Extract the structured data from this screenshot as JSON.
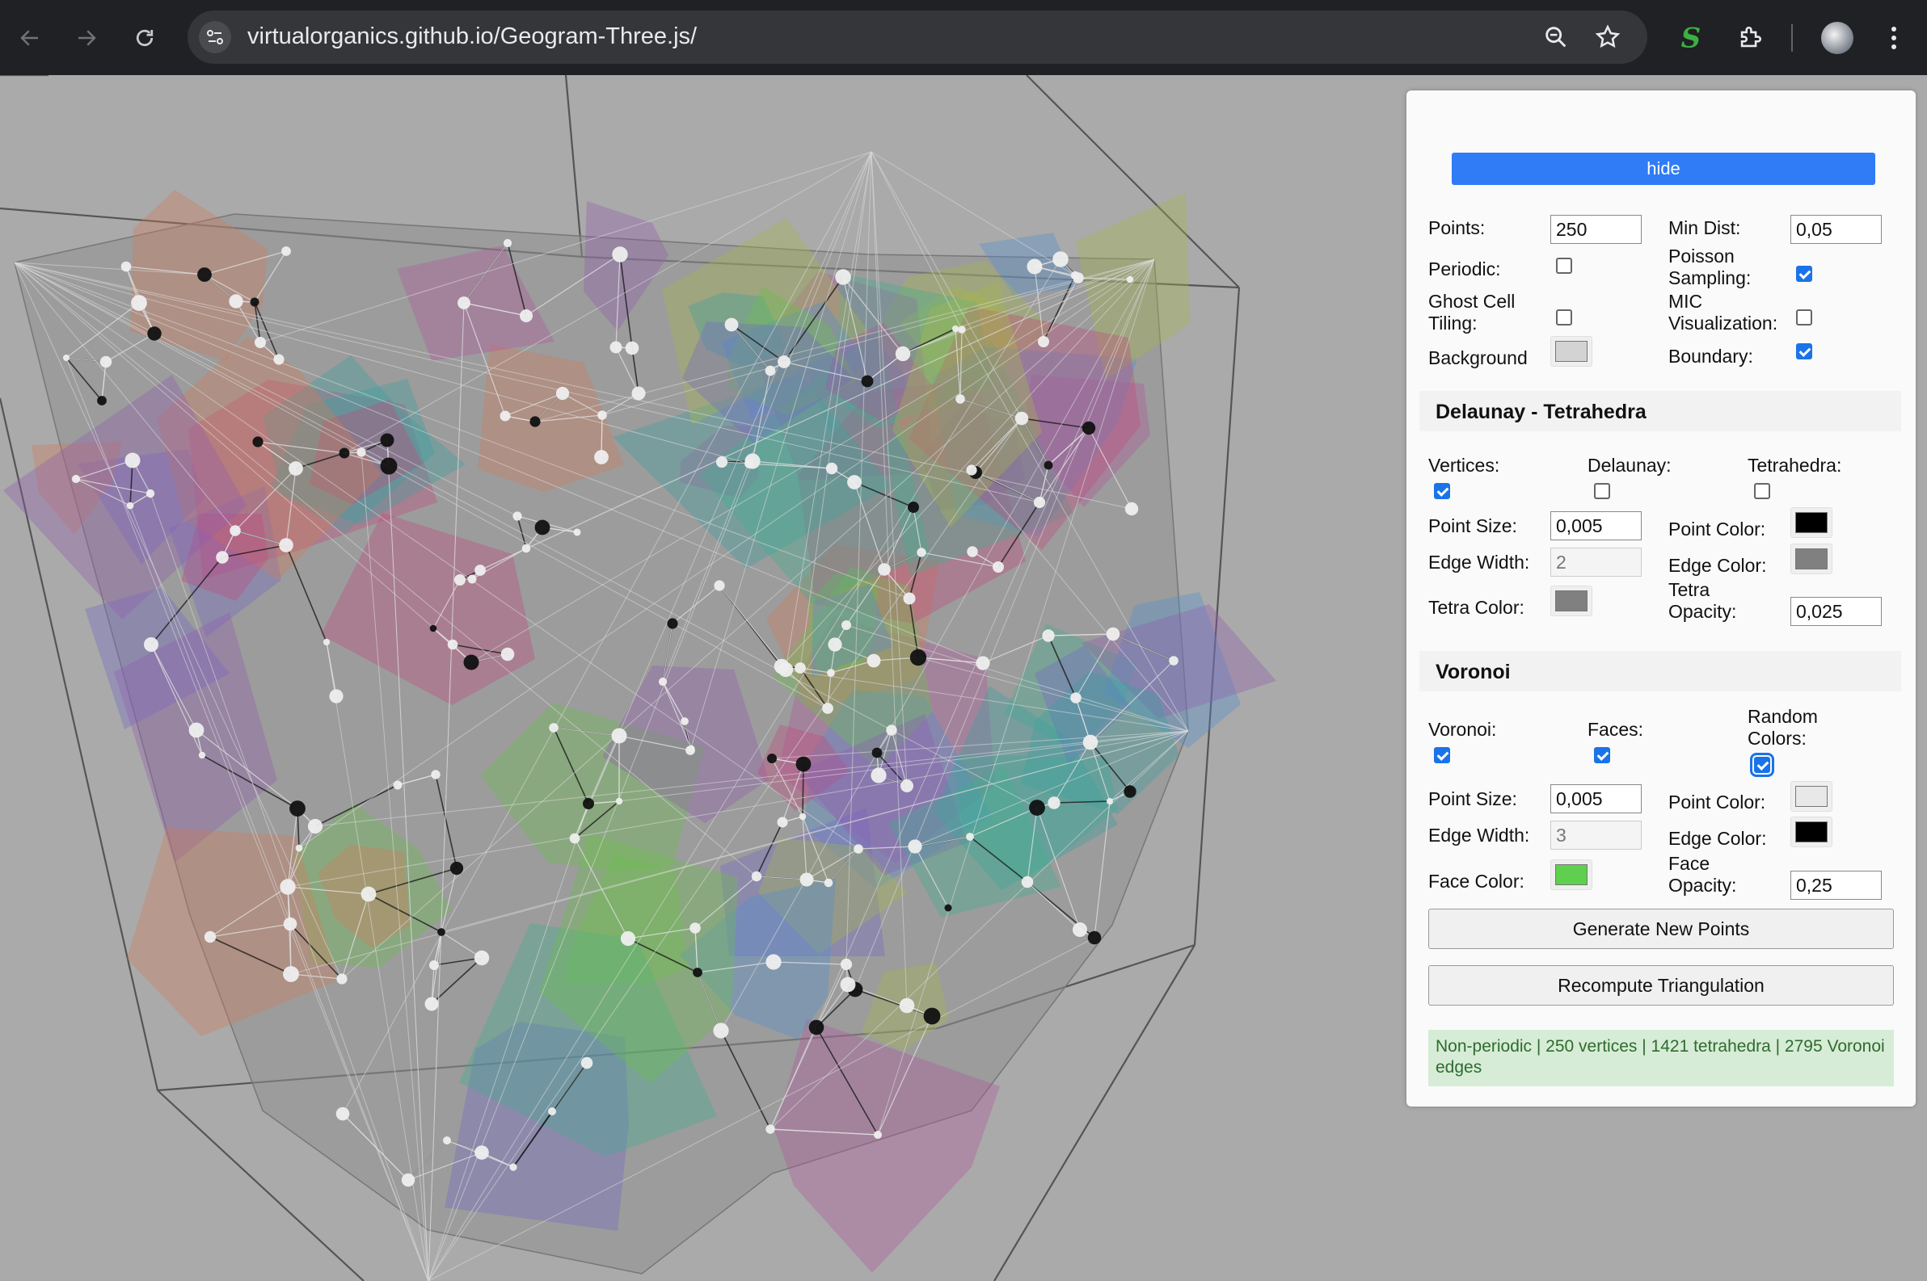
{
  "browser": {
    "url": "virtualorganics.github.io/Geogram-Three.js/",
    "icons": [
      "back-arrow-icon",
      "forward-arrow-icon",
      "reload-icon",
      "site-info-icon",
      "zoom-icon",
      "bookmark-star-icon",
      "extension-s-icon",
      "extensions-puzzle-icon",
      "profile-avatar",
      "more-menu-icon"
    ]
  },
  "panel": {
    "hide_label": "hide",
    "points_label": "Points:",
    "points_value": "250",
    "min_dist_label": "Min Dist:",
    "min_dist_value": "0,05",
    "periodic_label": "Periodic:",
    "periodic_checked": false,
    "poisson_label_1": "Poisson",
    "poisson_label_2": "Sampling:",
    "poisson_checked": true,
    "ghost_label_1": "Ghost Cell",
    "ghost_label_2": "Tiling:",
    "ghost_checked": false,
    "mic_label_1": "MIC",
    "mic_label_2": "Visualization:",
    "mic_checked": false,
    "background_label": "Background",
    "background_color": "#d3d3d3",
    "boundary_label": "Boundary:",
    "boundary_checked": true,
    "delaunay_section": {
      "title": "Delaunay - Tetrahedra",
      "vertices_label": "Vertices:",
      "vertices_checked": true,
      "delaunay_label": "Delaunay:",
      "delaunay_checked": false,
      "tetrahedra_label": "Tetrahedra:",
      "tetrahedra_checked": false,
      "point_size_label": "Point Size:",
      "point_size_value": "0,005",
      "point_color_label": "Point Color:",
      "point_color": "#000000",
      "edge_width_label": "Edge Width:",
      "edge_width_value": "2",
      "edge_color_label": "Edge Color:",
      "edge_color": "#808080",
      "tetra_color_label": "Tetra Color:",
      "tetra_color": "#808080",
      "tetra_opacity_label_1": "Tetra",
      "tetra_opacity_label_2": "Opacity:",
      "tetra_opacity_value": "0,025"
    },
    "voronoi_section": {
      "title": "Voronoi",
      "voronoi_label": "Voronoi:",
      "voronoi_checked": true,
      "faces_label": "Faces:",
      "faces_checked": true,
      "random_colors_label_1": "Random",
      "random_colors_label_2": "Colors:",
      "random_colors_checked": true,
      "point_size_label": "Point Size:",
      "point_size_value": "0,005",
      "point_color_label": "Point Color:",
      "point_color": "#e8e8e8",
      "edge_width_label": "Edge Width:",
      "edge_width_value": "3",
      "edge_color_label": "Edge Color:",
      "edge_color": "#000000",
      "face_color_label": "Face Color:",
      "face_color": "#5fcf4f",
      "face_opacity_label_1": "Face",
      "face_opacity_label_2": "Opacity:",
      "face_opacity_value": "0,25"
    },
    "generate_label": "Generate New Points",
    "recompute_label": "Recompute Triangulation",
    "status_text": "Non-periodic | 250 vertices | 1421 tetrahedra | 2795 Voronoi edges"
  }
}
